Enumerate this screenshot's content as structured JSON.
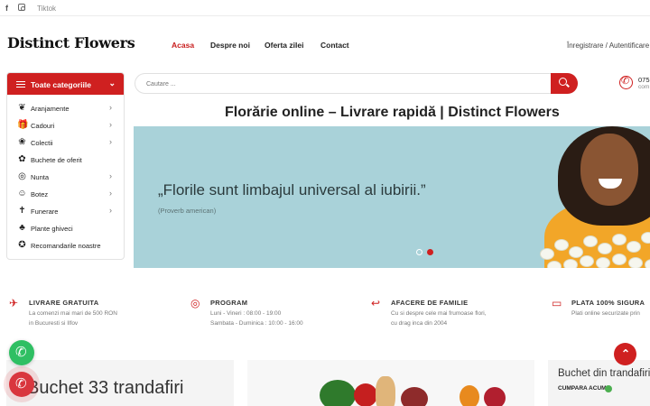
{
  "topbar": {
    "facebook_icon": "f",
    "instagram_icon": "instagram-icon",
    "tiktok_label": "Tiktok"
  },
  "header": {
    "logo": "Distinct Flowers",
    "nav": [
      "Acasa",
      "Despre noi",
      "Oferta zilei",
      "Contact"
    ],
    "auth": "Înregistrare / Autentificare"
  },
  "categories": {
    "title": "Toate categoriile",
    "items": [
      {
        "label": "Aranjamente",
        "icon": "❦",
        "has_submenu": true
      },
      {
        "label": "Cadouri",
        "icon": "🎁",
        "has_submenu": true
      },
      {
        "label": "Colectii",
        "icon": "❀",
        "has_submenu": true
      },
      {
        "label": "Buchete de oferit",
        "icon": "✿",
        "has_submenu": false
      },
      {
        "label": "Nunta",
        "icon": "◎",
        "has_submenu": true
      },
      {
        "label": "Botez",
        "icon": "☺",
        "has_submenu": true
      },
      {
        "label": "Funerare",
        "icon": "✝",
        "has_submenu": true
      },
      {
        "label": "Plante ghiveci",
        "icon": "♣",
        "has_submenu": false
      },
      {
        "label": "Recomandarile noastre",
        "icon": "✪",
        "has_submenu": false
      }
    ]
  },
  "search": {
    "placeholder": "Cautare ..."
  },
  "contact": {
    "phone": "075",
    "sub": "com"
  },
  "page_title": "Florărie online – Livrare rapidă | Distinct Flowers",
  "hero": {
    "quote": "„Florile sunt limbajul universal al iubirii.”",
    "author": "(Proverb american)"
  },
  "features": [
    {
      "title": "LIVRARE GRATUITA",
      "icon": "✈",
      "lines": [
        "La comenzi mai mari de 500 RON",
        "in Bucuresti si Ilfov"
      ]
    },
    {
      "title": "PROGRAM",
      "icon": "◎",
      "lines": [
        "Luni - Vineri : 08:00 - 19:00",
        "Sambata - Duminica : 10:00 - 16:00"
      ]
    },
    {
      "title": "AFACERE DE FAMILIE",
      "icon": "↩",
      "lines": [
        "Cu si despre cele mai frumoase flori,",
        "cu drag inca din 2004"
      ]
    },
    {
      "title": "PLATA 100% SIGURA",
      "icon": "▭",
      "lines": [
        "Plati online securizate prin"
      ]
    }
  ],
  "cards": {
    "card1_title": "Buchet 33 trandafiri",
    "card3_title": "Buchet din trandafiri",
    "card3_cta": "CUMPARA ACUM"
  },
  "colors": {
    "accent": "#cf2020",
    "whatsapp": "#2fbf63",
    "hero_bg": "#a9d2d9"
  }
}
